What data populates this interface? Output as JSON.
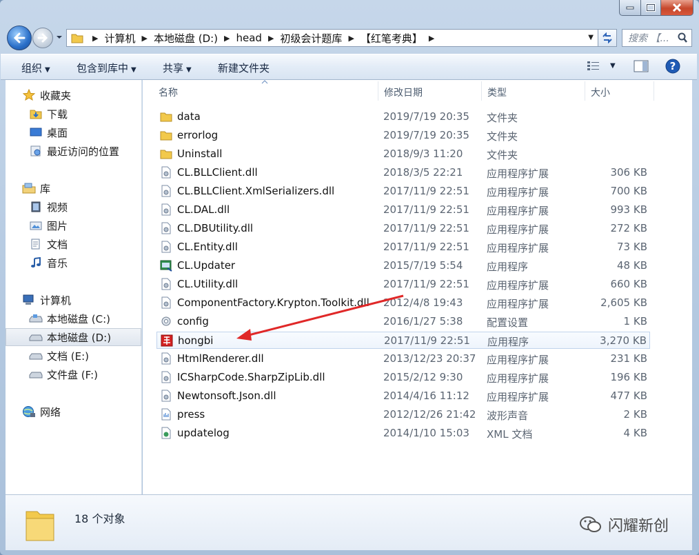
{
  "address": {
    "crumbs": [
      "计算机",
      "本地磁盘 (D:)",
      "head",
      "初级会计题库",
      "【红笔考典】"
    ]
  },
  "search": {
    "placeholder": "搜索 【..."
  },
  "toolbar": {
    "organize": "组织",
    "include_in_library": "包含到库中",
    "share": "共享",
    "new_folder": "新建文件夹"
  },
  "nav": {
    "favorites": "收藏夹",
    "downloads": "下载",
    "desktop": "桌面",
    "recent": "最近访问的位置",
    "libraries": "库",
    "videos": "视频",
    "pictures": "图片",
    "documents": "文档",
    "music": "音乐",
    "computer": "计算机",
    "drive_c": "本地磁盘 (C:)",
    "drive_d": "本地磁盘 (D:)",
    "drive_e": "文档 (E:)",
    "drive_f": "文件盘 (F:)",
    "network": "网络"
  },
  "columns": {
    "name": "名称",
    "date": "修改日期",
    "type": "类型",
    "size": "大小"
  },
  "files": [
    {
      "name": "data",
      "date": "2019/7/19 20:35",
      "type": "文件夹",
      "size": "",
      "icon": "folder-icon"
    },
    {
      "name": "errorlog",
      "date": "2019/7/19 20:35",
      "type": "文件夹",
      "size": "",
      "icon": "folder-icon"
    },
    {
      "name": "Uninstall",
      "date": "2018/9/3 11:20",
      "type": "文件夹",
      "size": "",
      "icon": "folder-icon"
    },
    {
      "name": "CL.BLLClient.dll",
      "date": "2018/3/5 22:21",
      "type": "应用程序扩展",
      "size": "306 KB",
      "icon": "dll-icon"
    },
    {
      "name": "CL.BLLClient.XmlSerializers.dll",
      "date": "2017/11/9 22:51",
      "type": "应用程序扩展",
      "size": "700 KB",
      "icon": "dll-icon"
    },
    {
      "name": "CL.DAL.dll",
      "date": "2017/11/9 22:51",
      "type": "应用程序扩展",
      "size": "993 KB",
      "icon": "dll-icon"
    },
    {
      "name": "CL.DBUtility.dll",
      "date": "2017/11/9 22:51",
      "type": "应用程序扩展",
      "size": "272 KB",
      "icon": "dll-icon"
    },
    {
      "name": "CL.Entity.dll",
      "date": "2017/11/9 22:51",
      "type": "应用程序扩展",
      "size": "73 KB",
      "icon": "dll-icon"
    },
    {
      "name": "CL.Updater",
      "date": "2015/7/19 5:54",
      "type": "应用程序",
      "size": "48 KB",
      "icon": "updater-app-icon"
    },
    {
      "name": "CL.Utility.dll",
      "date": "2017/11/9 22:51",
      "type": "应用程序扩展",
      "size": "660 KB",
      "icon": "dll-icon"
    },
    {
      "name": "ComponentFactory.Krypton.Toolkit.dll",
      "date": "2012/4/8 19:43",
      "type": "应用程序扩展",
      "size": "2,605 KB",
      "icon": "dll-icon"
    },
    {
      "name": "config",
      "date": "2016/1/27 5:38",
      "type": "配置设置",
      "size": "1 KB",
      "icon": "config-icon"
    },
    {
      "name": "hongbi",
      "date": "2017/11/9 22:51",
      "type": "应用程序",
      "size": "3,270 KB",
      "icon": "hongbi-app-icon"
    },
    {
      "name": "HtmlRenderer.dll",
      "date": "2013/12/23 20:37",
      "type": "应用程序扩展",
      "size": "231 KB",
      "icon": "dll-icon"
    },
    {
      "name": "ICSharpCode.SharpZipLib.dll",
      "date": "2015/2/12 9:30",
      "type": "应用程序扩展",
      "size": "196 KB",
      "icon": "dll-icon"
    },
    {
      "name": "Newtonsoft.Json.dll",
      "date": "2014/4/16 11:12",
      "type": "应用程序扩展",
      "size": "477 KB",
      "icon": "dll-icon"
    },
    {
      "name": "press",
      "date": "2012/12/26 21:42",
      "type": "波形声音",
      "size": "2 KB",
      "icon": "wav-icon"
    },
    {
      "name": "updatelog",
      "date": "2014/1/10 15:03",
      "type": "XML 文档",
      "size": "4 KB",
      "icon": "xml-icon"
    }
  ],
  "details": {
    "count": "18 个对象"
  },
  "watermark": {
    "text": "闪耀新创"
  },
  "colors": {
    "selection": "#eef4fc",
    "arrow": "#e02828",
    "window_frame": "#b3c8e0"
  }
}
